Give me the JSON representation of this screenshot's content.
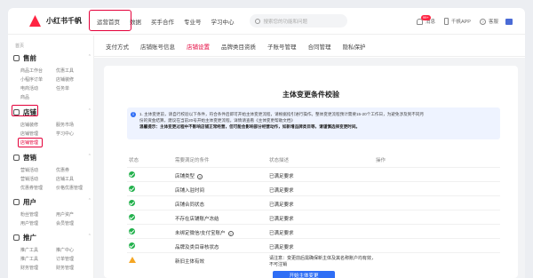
{
  "app": {
    "title": "小红书千帆"
  },
  "topnav": [
    "运营首页",
    "数据",
    "买手合作",
    "专业号",
    "学习中心"
  ],
  "search": {
    "placeholder": "搜索您的功能和问题"
  },
  "topright": {
    "message": "消息",
    "message_badge": "99+",
    "app": "千帆APP",
    "help": "客服"
  },
  "sidebar": {
    "top_label": "首页",
    "sections": [
      {
        "title": "售前",
        "items": [
          "商品工作台",
          "优惠工具",
          "小程序订单",
          "店铺装修",
          "电商活动",
          "任务单"
        ],
        "extra": "商品"
      },
      {
        "title": "店铺",
        "items": [
          "店铺装修",
          "服务市场",
          "店铺管理",
          "学习中心",
          "店铺管理"
        ]
      },
      {
        "title": "营销",
        "items": [
          "营销活动",
          "优惠券",
          "营销活动",
          "店铺工具",
          "优惠券管理",
          "价格优惠管理"
        ]
      },
      {
        "title": "用户",
        "items": [
          "粉丝管理",
          "用户资产",
          "用户管理",
          "会员管理"
        ]
      },
      {
        "title": "推广",
        "items": [
          "推广工具",
          "推广中心",
          "推广工具",
          "订单管理",
          "财务管理",
          "财务管理"
        ]
      }
    ]
  },
  "tabs": [
    "支付方式",
    "店铺账号信息",
    "店铺设置",
    "品牌类目资质",
    "子账号管理",
    "合同管理",
    "隐私保护"
  ],
  "panel": {
    "title": "主体变更条件校验",
    "notice_lines": [
      "1. 主体变更前，请自行校验以下条件，符合条件后即可开始主体变更流程，请根据指引进行操作。整体变更流程预计需要15-20个工作日，为避免涉及到不同月",
      "份的资金结算，建议在当前20号开始主体变更流程。详情请查看《主体变更帮助文档》",
      "温馨提示：主体变更过程中不影响店铺正常经营，但可能会影响部分经营动作，如新增品牌类目等，请谨慎选择变更时间。"
    ],
    "columns": [
      "状态",
      "需要满足的条件",
      "状态描述",
      "操作"
    ],
    "rows": [
      {
        "status": "ok",
        "condition": "店铺类型",
        "has_help": true,
        "desc": "已满足要求"
      },
      {
        "status": "ok",
        "condition": "店铺入驻时间",
        "has_help": false,
        "desc": "已满足要求"
      },
      {
        "status": "ok",
        "condition": "店铺合同状态",
        "has_help": false,
        "desc": "已满足要求"
      },
      {
        "status": "ok",
        "condition": "不存在店铺账户冻结",
        "has_help": false,
        "desc": "已满足要求"
      },
      {
        "status": "ok",
        "condition": "未绑定微信/支付宝账户",
        "has_help": true,
        "desc": "已满足要求"
      },
      {
        "status": "ok",
        "condition": "品牌及类目审核状态",
        "has_help": false,
        "desc": "已满足要求"
      },
      {
        "status": "warn",
        "condition": "新旧主体有效",
        "has_help": false,
        "desc": "请注意：变更前后需确保新主体及其名称账户均有效，不可注销"
      }
    ],
    "button": "开始主体变更"
  },
  "colors": {
    "accent": "#e4003a",
    "primary": "#2f6ef5",
    "success": "#22b14c",
    "warning": "#f5a623"
  }
}
